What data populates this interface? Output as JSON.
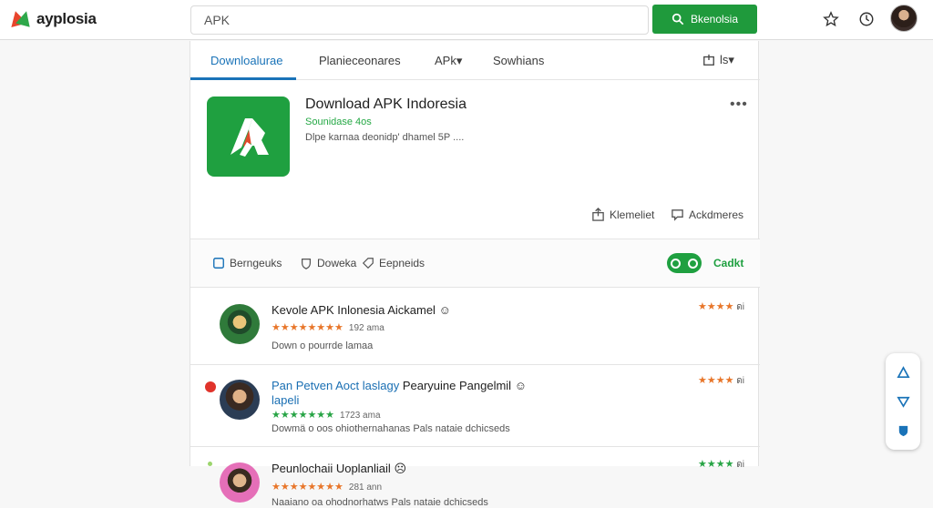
{
  "brand": {
    "name": "ayplosia"
  },
  "search": {
    "value": "APK",
    "button_label": "Bkenolsia"
  },
  "tabs": [
    {
      "label": "Downloalurae"
    },
    {
      "label": "Planieceonares"
    },
    {
      "label": "APk▾"
    },
    {
      "label": "Sowhians"
    }
  ],
  "tab_menu": {
    "label": "ls▾"
  },
  "app": {
    "title": "Download APK Indoresia",
    "subtitle": "Sounidase 4os",
    "description": "Dlpe karnaa deonidp' dhamel 5P ....",
    "more": "•••",
    "share_label": "Klemeliet",
    "comment_label": "Ackdmeres"
  },
  "filters": [
    {
      "label": "Berngeuks"
    },
    {
      "label": "Doweka"
    },
    {
      "label": "Eepneids"
    }
  ],
  "toggle_label": "Cadkt",
  "reviews": [
    {
      "name": "Kevole APK Inlonesia Aickamel",
      "stars": "★★★★★★★★",
      "count": "192 ama",
      "body": "Down o pourrde lamaa",
      "rating": "★★★★",
      "rating_value": "ดi"
    },
    {
      "name_prefix": "Pan Petven Aoct laslagy",
      "name_rest": "Pearyuine Pangelmil",
      "name_line2": "lapeli",
      "stars": "★★★★★★★",
      "count": "1723 ama",
      "body": "Dowmä o oos ohiothernahanas Pals nataie dchicseds",
      "rating": "★★★★",
      "rating_value": "ดi"
    },
    {
      "name": "Peunlochaii Uoplanliail",
      "stars": "★★★★★★★★",
      "count": "281 ann",
      "body": "Naaiano oa ohodnorhatws Pals nataie dchicseds",
      "rating": "★★★★",
      "rating_value": "ดi"
    }
  ],
  "colors": {
    "accent_green": "#1f9a3c",
    "tab_blue": "#1a73b8",
    "star_orange": "#e8762a"
  }
}
